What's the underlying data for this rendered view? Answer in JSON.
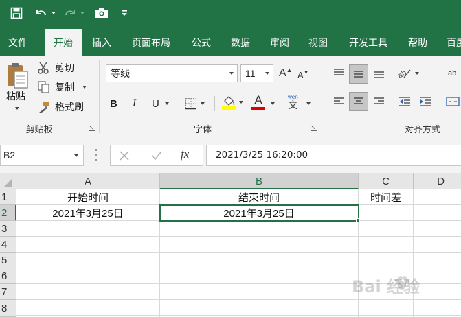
{
  "quick_access": {
    "save_icon": "save-icon",
    "undo_icon": "undo-icon",
    "redo_icon": "redo-icon",
    "camera_icon": "camera-icon",
    "customize_icon": "customize-qat-icon"
  },
  "tabs": [
    {
      "label": "文件",
      "active": false
    },
    {
      "label": "开始",
      "active": true
    },
    {
      "label": "插入",
      "active": false
    },
    {
      "label": "页面布局",
      "active": false
    },
    {
      "label": "公式",
      "active": false
    },
    {
      "label": "数据",
      "active": false
    },
    {
      "label": "审阅",
      "active": false
    },
    {
      "label": "视图",
      "active": false
    },
    {
      "label": "开发工具",
      "active": false
    },
    {
      "label": "帮助",
      "active": false
    },
    {
      "label": "百度",
      "active": false
    }
  ],
  "ribbon": {
    "clipboard": {
      "paste_label": "粘贴",
      "cut_label": "剪切",
      "copy_label": "复制",
      "format_painter_label": "格式刷",
      "group_label": "剪贴板"
    },
    "font": {
      "font_name": "等线",
      "font_size": "11",
      "bold": "B",
      "italic": "I",
      "underline": "U",
      "font_color_glyph": "A",
      "phonetic_top": "wén",
      "phonetic_bottom": "文",
      "fill_color": "#ffff00",
      "font_color": "#e00000",
      "group_label": "字体"
    },
    "alignment": {
      "wrap_text_glyph": "ab",
      "group_label": "对齐方式"
    }
  },
  "formula_bar": {
    "name_box": "B2",
    "fx_label": "fx",
    "formula": "2021/3/25  16:20:00"
  },
  "grid": {
    "columns": [
      "A",
      "B",
      "C",
      "D"
    ],
    "rows": [
      "1",
      "2",
      "3",
      "4",
      "5",
      "6",
      "7",
      "8"
    ],
    "selected_column": "B",
    "selected_row": "2",
    "cells": {
      "A1": "开始时间",
      "B1": "结束时间",
      "C1": "时间差",
      "A2": "2021年3月25日",
      "B2": "2021年3月25日"
    }
  },
  "watermark": "Bai 经验",
  "colors": {
    "excel_green": "#217346",
    "ribbon_bg": "#f3f3f3",
    "header_bg": "#e6e6e6"
  }
}
